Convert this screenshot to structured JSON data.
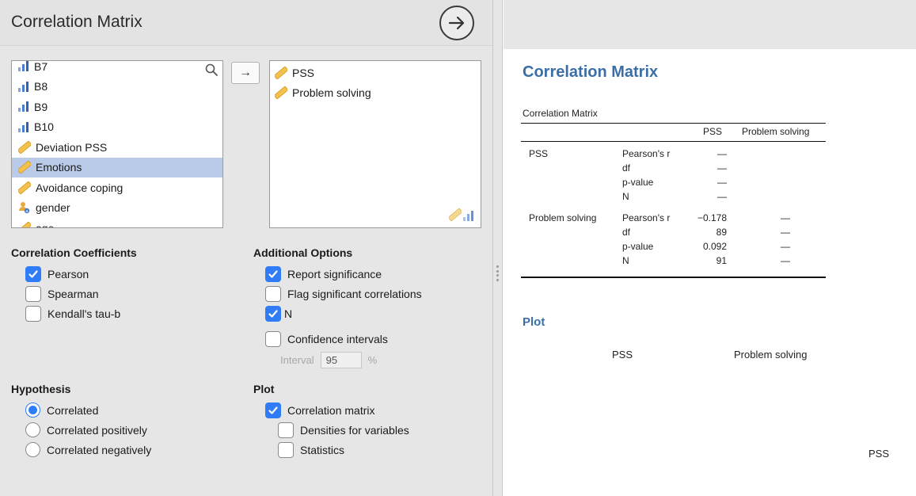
{
  "left": {
    "title": "Correlation Matrix",
    "variables": [
      {
        "label": "B7",
        "icon": "ordinal-icon",
        "selected": false
      },
      {
        "label": "B8",
        "icon": "ordinal-icon",
        "selected": false
      },
      {
        "label": "B9",
        "icon": "ordinal-icon",
        "selected": false
      },
      {
        "label": "B10",
        "icon": "ordinal-icon",
        "selected": false
      },
      {
        "label": "Deviation PSS",
        "icon": "continuous-icon",
        "selected": false
      },
      {
        "label": "Emotions",
        "icon": "continuous-icon",
        "selected": true
      },
      {
        "label": "Avoidance coping",
        "icon": "continuous-icon",
        "selected": false
      },
      {
        "label": "gender",
        "icon": "nominal-icon",
        "selected": false
      },
      {
        "label": "age",
        "icon": "continuous-icon",
        "selected": false
      }
    ],
    "move_button": "→",
    "target_vars": [
      "PSS",
      "Problem solving"
    ],
    "coefficients": {
      "title": "Correlation Coefficients",
      "pearson": "Pearson",
      "spearman": "Spearman",
      "kendall": "Kendall's tau-b"
    },
    "additional": {
      "title": "Additional Options",
      "report_sig": "Report significance",
      "flag_sig": "Flag significant correlations",
      "n": "N",
      "ci": "Confidence intervals",
      "interval_label": "Interval",
      "interval_value": "95",
      "interval_unit": "%"
    },
    "hypothesis": {
      "title": "Hypothesis",
      "correlated": "Correlated",
      "positive": "Correlated positively",
      "negative": "Correlated negatively"
    },
    "plot": {
      "title": "Plot",
      "matrix": "Correlation matrix",
      "densities": "Densities for variables",
      "statistics": "Statistics"
    }
  },
  "results": {
    "title": "Correlation Matrix",
    "table_caption": "Correlation Matrix",
    "col_pss": "PSS",
    "col_ps": "Problem solving",
    "row_pss": "PSS",
    "row_ps": "Problem solving",
    "stats": [
      "Pearson's r",
      "df",
      "p-value",
      "N"
    ],
    "pss_pss": [
      "—",
      "—",
      "—",
      "—"
    ],
    "ps_pss": [
      "−0.178",
      "89",
      "0.092",
      "91"
    ],
    "ps_ps": [
      "—",
      "—",
      "—",
      "—"
    ],
    "plot_title": "Plot",
    "plot_col1": "PSS",
    "plot_col2": "Problem solving",
    "plot_row1": "PSS"
  },
  "colors": {
    "accent": "#2f7cf6",
    "heading": "#3a6ea8",
    "selection": "#b9cbe8"
  }
}
